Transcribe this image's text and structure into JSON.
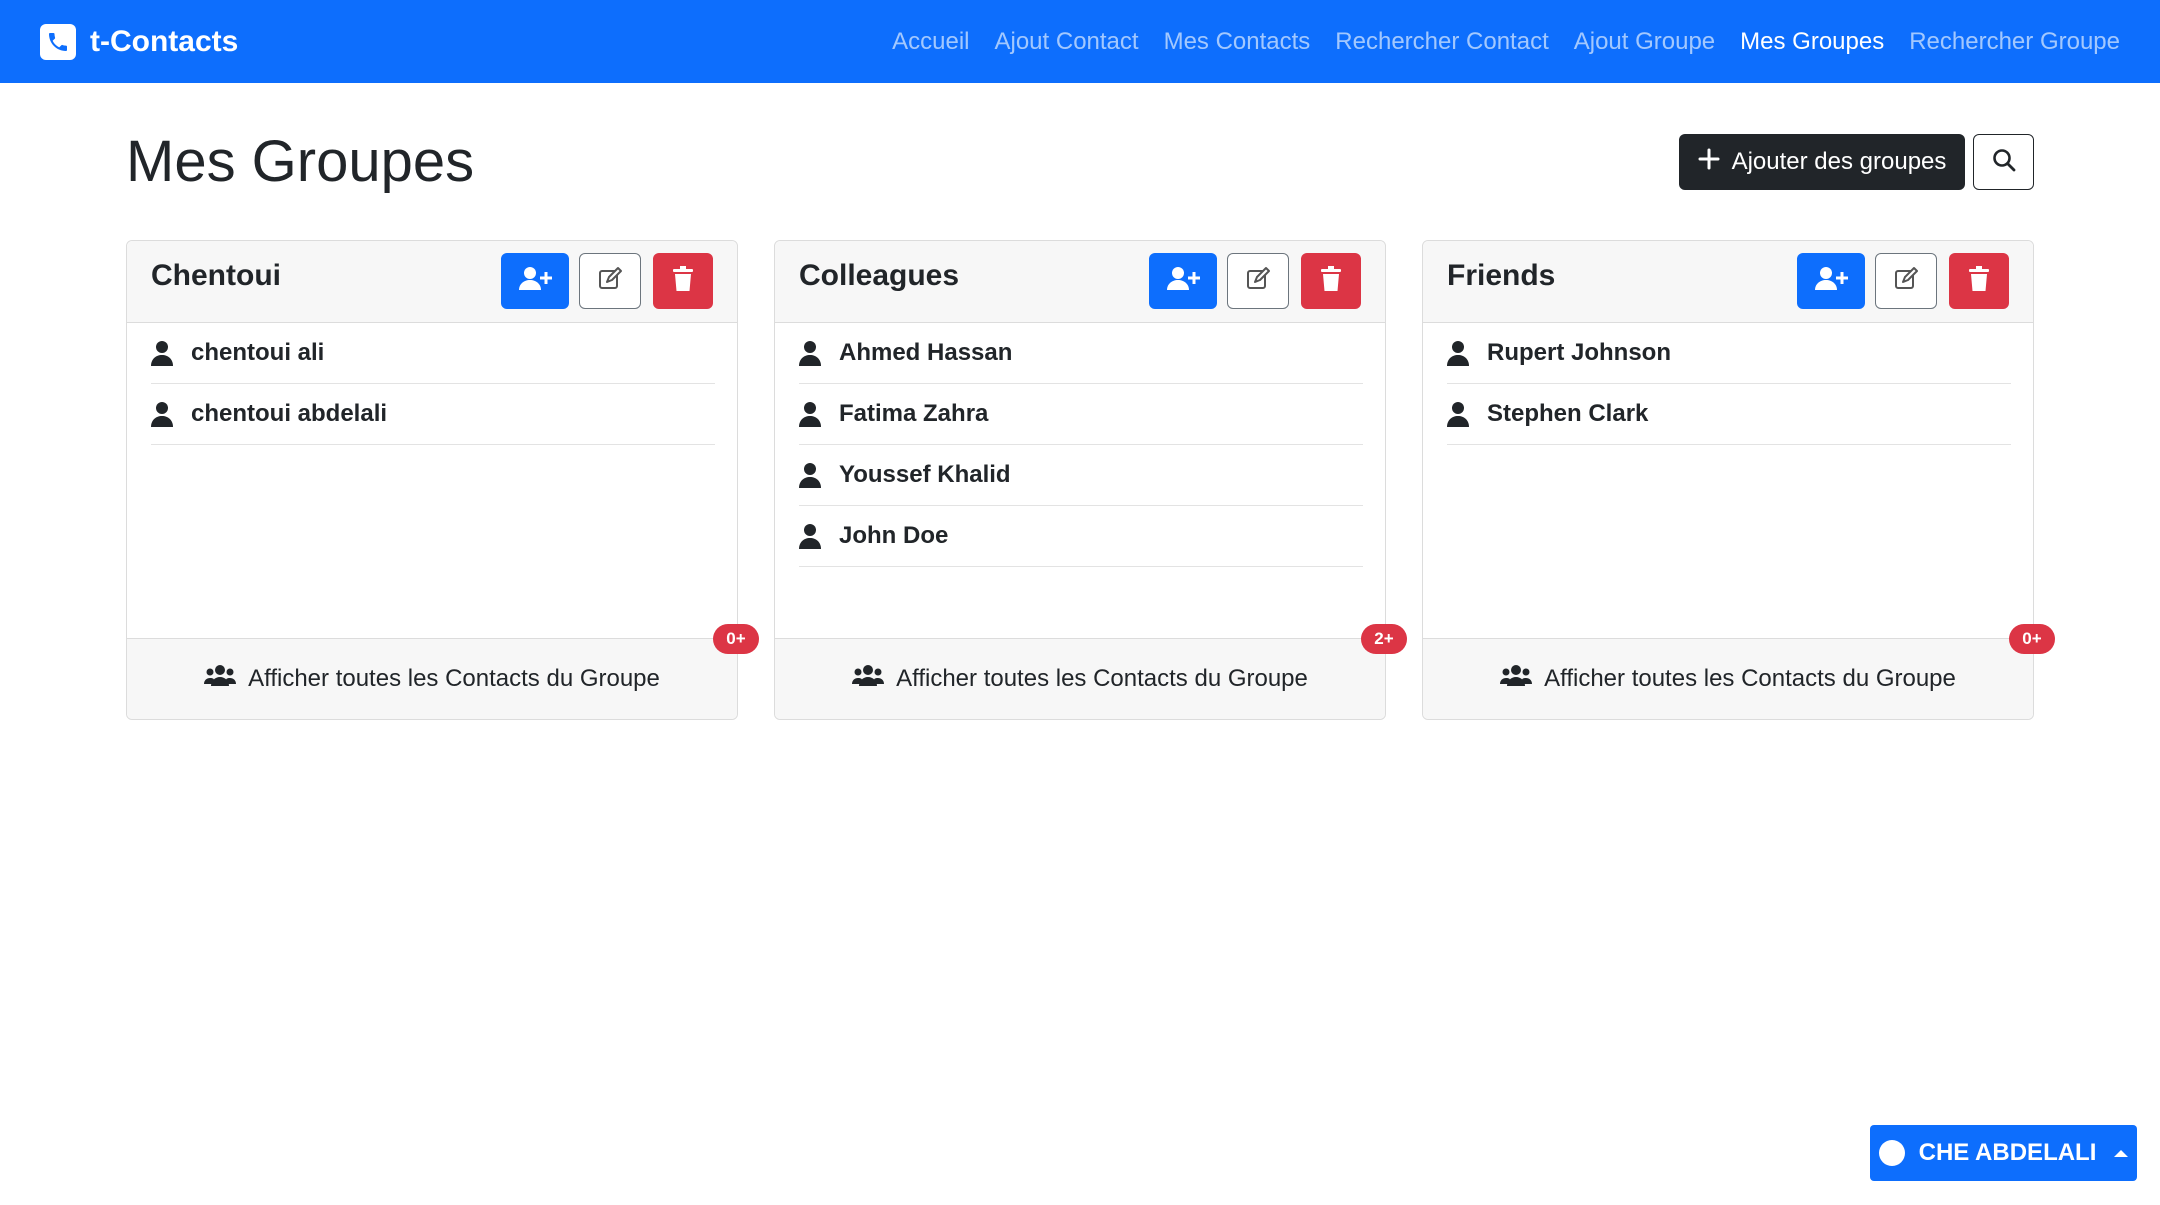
{
  "app": {
    "brand": "t-Contacts",
    "nav": [
      {
        "label": "Accueil",
        "active": false
      },
      {
        "label": "Ajout Contact",
        "active": false
      },
      {
        "label": "Mes Contacts",
        "active": false
      },
      {
        "label": "Rechercher Contact",
        "active": false
      },
      {
        "label": "Ajout Groupe",
        "active": false
      },
      {
        "label": "Mes Groupes",
        "active": true
      },
      {
        "label": "Rechercher Groupe",
        "active": false
      }
    ]
  },
  "page": {
    "title": "Mes Groupes",
    "add_groups_label": "Ajouter des groupes",
    "footer_label": "Afficher toutes les Contacts du Groupe"
  },
  "groups": [
    {
      "name": "Chentoui",
      "badge": "0+",
      "members": [
        "chentoui ali",
        "chentoui abdelali"
      ]
    },
    {
      "name": "Colleagues",
      "badge": "2+",
      "members": [
        "Ahmed Hassan",
        "Fatima Zahra",
        "Youssef Khalid",
        "John Doe"
      ]
    },
    {
      "name": "Friends",
      "badge": "0+",
      "members": [
        "Rupert Johnson",
        "Stephen Clark"
      ]
    }
  ],
  "user": {
    "name": "CHE ABDELALI"
  },
  "colors": {
    "primary": "#0d6efd",
    "danger": "#dc3545",
    "dark": "#212529"
  }
}
